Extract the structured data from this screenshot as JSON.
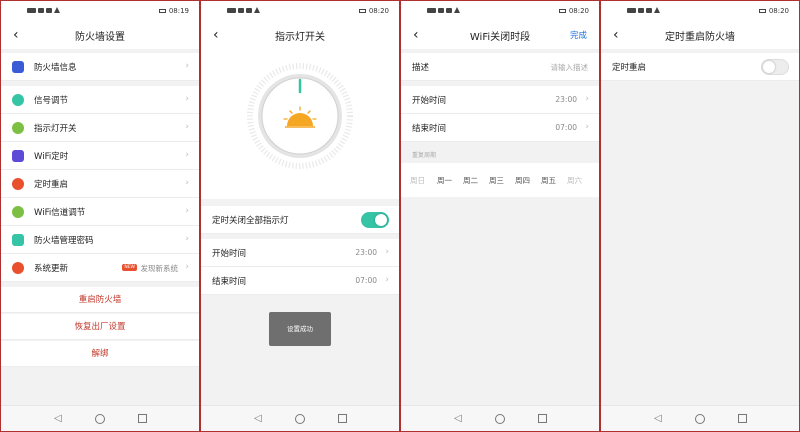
{
  "status": {
    "times": [
      "08:19",
      "08:20",
      "08:20",
      "08:20"
    ]
  },
  "screen1": {
    "title": "防火墙设置",
    "items": [
      {
        "label": "防火墙信息",
        "icon": "firewall-info-icon",
        "color": "#3b5bd6"
      },
      {
        "label": "信号调节",
        "icon": "signal-adjust-icon",
        "color": "#35c4a5"
      },
      {
        "label": "指示灯开关",
        "icon": "indicator-light-icon",
        "color": "#7bc043"
      },
      {
        "label": "WiFi定时",
        "icon": "wifi-timer-icon",
        "color": "#5b4bd6"
      },
      {
        "label": "定时重启",
        "icon": "timed-restart-icon",
        "color": "#e8502e"
      },
      {
        "label": "WiFi信道调节",
        "icon": "wifi-channel-icon",
        "color": "#7bc043"
      },
      {
        "label": "防火墙管理密码",
        "icon": "admin-password-icon",
        "color": "#35c4a5"
      },
      {
        "label": "系统更新",
        "icon": "system-update-icon",
        "color": "#e8502e"
      }
    ],
    "update_badge": "NEW",
    "update_text": "发现新系统",
    "actions": {
      "restart": "重启防火墙",
      "factory_reset": "恢复出厂设置",
      "unbind": "解绑"
    }
  },
  "screen2": {
    "title": "指示灯开关",
    "toggle_label": "定时关闭全部指示灯",
    "toggle_on": true,
    "start_label": "开始时间",
    "start_value": "23:00",
    "end_label": "结束时间",
    "end_value": "07:00",
    "toast": "设置成功"
  },
  "screen3": {
    "title": "WiFi关闭时段",
    "done": "完成",
    "desc_label": "描述",
    "desc_placeholder": "请输入描述",
    "start_label": "开始时间",
    "start_value": "23:00",
    "end_label": "结束时间",
    "end_value": "07:00",
    "repeat_label": "重复周期",
    "weekdays": [
      "周日",
      "周一",
      "周二",
      "周三",
      "周四",
      "周五",
      "周六"
    ]
  },
  "screen4": {
    "title": "定时重启防火墙",
    "toggle_label": "定时重启",
    "toggle_on": false
  },
  "colors": {
    "accent_green": "#35c4a5",
    "danger_red": "#c0392b",
    "link_blue": "#1d6fd8",
    "sun_orange": "#f5a623"
  }
}
